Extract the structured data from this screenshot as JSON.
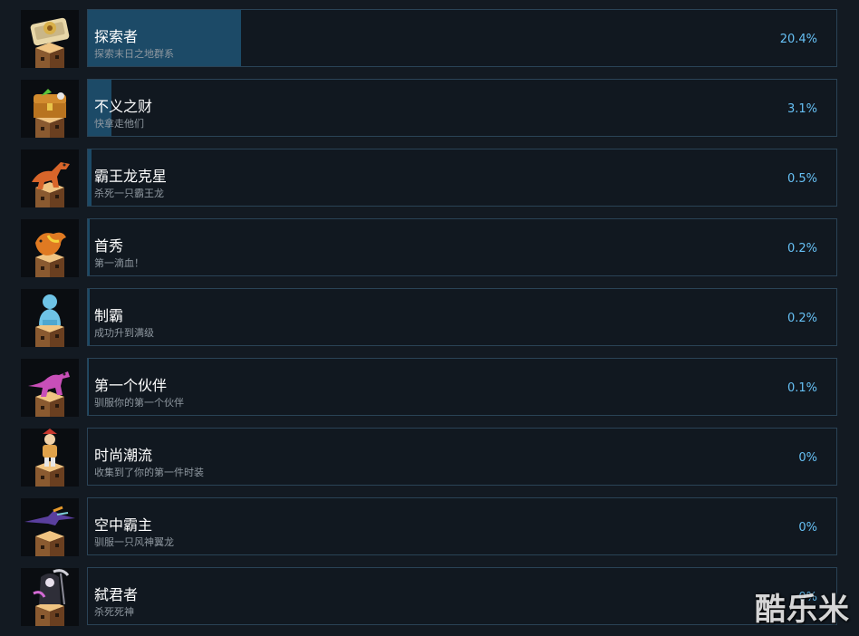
{
  "achievements": [
    {
      "title": "探索者",
      "description": "探索末日之地群系",
      "percent": "20.4%",
      "progress": 0.204,
      "icon": "map-scroll-icon",
      "color": "#e8d7a8"
    },
    {
      "title": "不义之财",
      "description": "快拿走他们",
      "percent": "3.1%",
      "progress": 0.031,
      "icon": "treasure-chest-icon",
      "color": "#d28b2e"
    },
    {
      "title": "霸王龙克星",
      "description": "杀死一只霸王龙",
      "percent": "0.5%",
      "progress": 0.005,
      "icon": "t-rex-icon",
      "color": "#d8652a"
    },
    {
      "title": "首秀",
      "description": "第一滴血！",
      "percent": "0.2%",
      "progress": 0.002,
      "icon": "bird-statue-icon",
      "color": "#e07a22"
    },
    {
      "title": "制霸",
      "description": "成功升到满级",
      "percent": "0.2%",
      "progress": 0.002,
      "icon": "bust-statue-icon",
      "color": "#6ec3e6"
    },
    {
      "title": "第一个伙伴",
      "description": "驯服你的第一个伙伴",
      "percent": "0.1%",
      "progress": 0.001,
      "icon": "raptor-icon",
      "color": "#c84fb8"
    },
    {
      "title": "时尚潮流",
      "description": "收集到了你的第一件时装",
      "percent": "0%",
      "progress": 0,
      "icon": "costume-figure-icon",
      "color": "#e0a24a"
    },
    {
      "title": "空中霸主",
      "description": "驯服一只风神翼龙",
      "percent": "0%",
      "progress": 0,
      "icon": "pterosaur-icon",
      "color": "#5a3f9e"
    },
    {
      "title": "弑君者",
      "description": "杀死死神",
      "percent": "0%",
      "progress": 0,
      "icon": "reaper-icon",
      "color": "#8a8a96"
    }
  ],
  "watermark": "酷乐米"
}
